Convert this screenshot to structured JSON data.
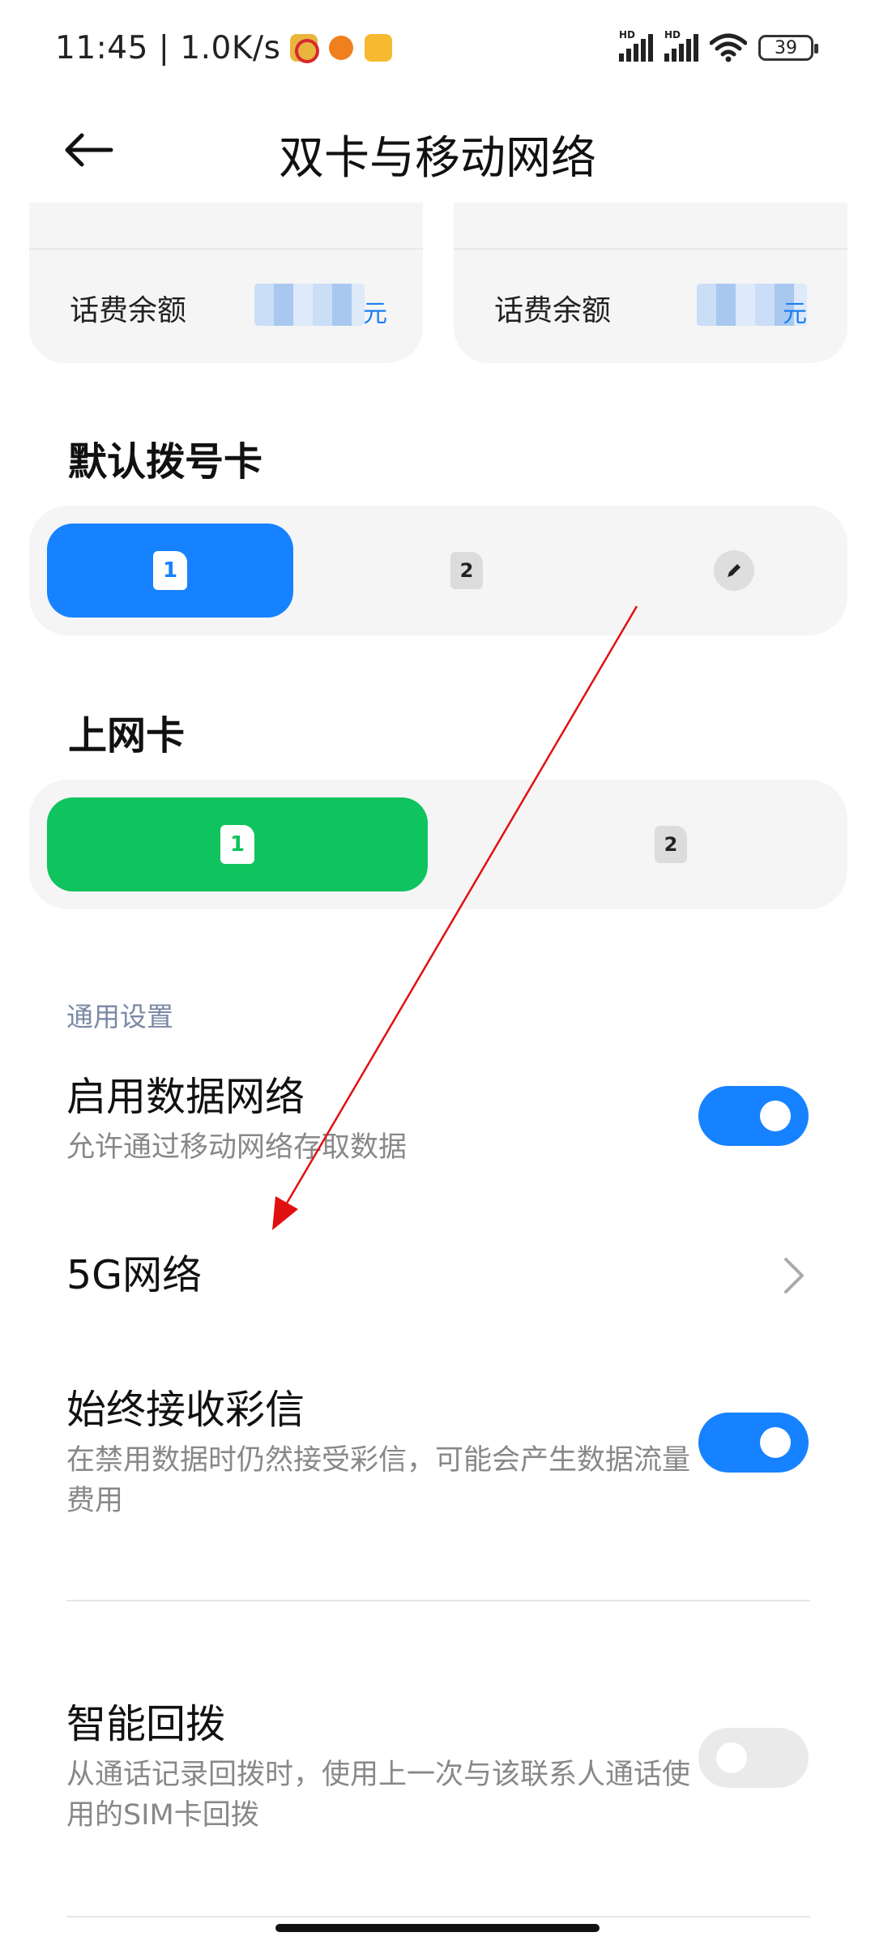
{
  "status_bar": {
    "time_speed": "11:45 | 1.0K/s",
    "hd_label": "HD",
    "battery": "39",
    "app_icons": [
      "telecom-icon",
      "orange-app-icon",
      "chat-app-icon"
    ]
  },
  "header": {
    "title": "双卡与移动网络",
    "back_icon": "arrow-left-icon"
  },
  "cards": [
    {
      "label": "话费余额",
      "value": "(blurred)",
      "unit": "元"
    },
    {
      "label": "话费余额",
      "value": "(blurred)",
      "unit": "元"
    }
  ],
  "default_dial": {
    "title": "默认拨号卡",
    "options": [
      "1",
      "2"
    ],
    "selected": "1",
    "edit_icon": "pencil-icon"
  },
  "data_sim": {
    "title": "上网卡",
    "options": [
      "1",
      "2"
    ],
    "selected": "1"
  },
  "general": {
    "label": "通用设置",
    "mobile_data": {
      "title": "启用数据网络",
      "subtitle": "允许通过移动网络存取数据",
      "enabled": true
    },
    "network_5g": {
      "title": "5G网络"
    },
    "mms": {
      "title": "始终接收彩信",
      "subtitle": "在禁用数据时仍然接受彩信，可能会产生数据流量费用",
      "enabled": true
    },
    "smart_redial": {
      "title": "智能回拨",
      "subtitle": "从通话记录回拨时，使用上一次与该联系人通话使用的SIM卡回拨",
      "enabled": false
    }
  },
  "colors": {
    "accent_blue": "#1782ff",
    "accent_green": "#0fc45e",
    "annotation_red": "#e01010"
  }
}
